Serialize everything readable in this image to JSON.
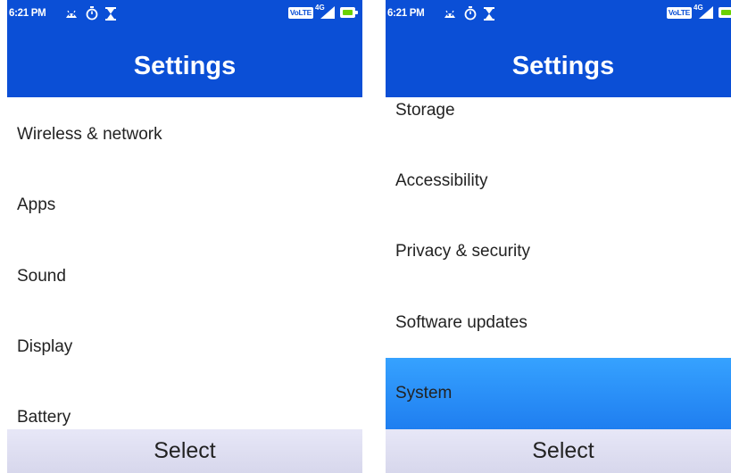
{
  "screens": [
    {
      "status": {
        "time": "6:21 PM",
        "volte": "VoLTE",
        "network": "4G"
      },
      "title": "Settings",
      "items": [
        "Wireless & network",
        "Apps",
        "Sound",
        "Display",
        "Battery"
      ],
      "selected_index": null,
      "softkey": "Select"
    },
    {
      "status": {
        "time": "6:21 PM",
        "volte": "VoLTE",
        "network": "4G"
      },
      "title": "Settings",
      "items": [
        "Storage",
        "Accessibility",
        "Privacy & security",
        "Software updates",
        "System"
      ],
      "selected_index": 4,
      "softkey": "Select"
    }
  ],
  "colors": {
    "header": "#0b4fd6",
    "selected": "#2f93ff",
    "softkey_bar": "#dcdcee",
    "battery": "#6bd100"
  }
}
